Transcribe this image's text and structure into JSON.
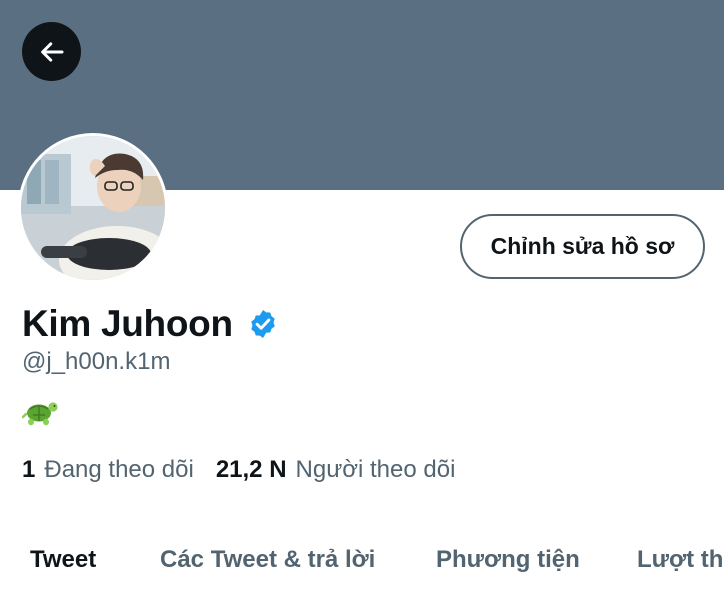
{
  "profile": {
    "display_name": "Kim Juhoon",
    "handle": "@j_h00n.k1m",
    "bio_emoji": "turtle",
    "verified": true
  },
  "actions": {
    "edit_profile_label": "Chỉnh sửa hồ sơ"
  },
  "stats": {
    "following_count": "1",
    "following_label": "Đang theo dõi",
    "followers_count": "21,2 N",
    "followers_label": "Người theo dõi"
  },
  "tabs": [
    {
      "label": "Tweet",
      "active": true
    },
    {
      "label": "Các Tweet & trả lời",
      "active": false
    },
    {
      "label": "Phương tiện",
      "active": false
    },
    {
      "label": "Lượt thích",
      "active": false
    }
  ],
  "colors": {
    "banner": "#5b6f82",
    "verified": "#1d9bf0",
    "text_primary": "#0f1419",
    "text_secondary": "#536471"
  },
  "icons": {
    "back": "arrow-left-icon",
    "verified": "verified-badge-icon",
    "bio": "turtle-icon"
  }
}
